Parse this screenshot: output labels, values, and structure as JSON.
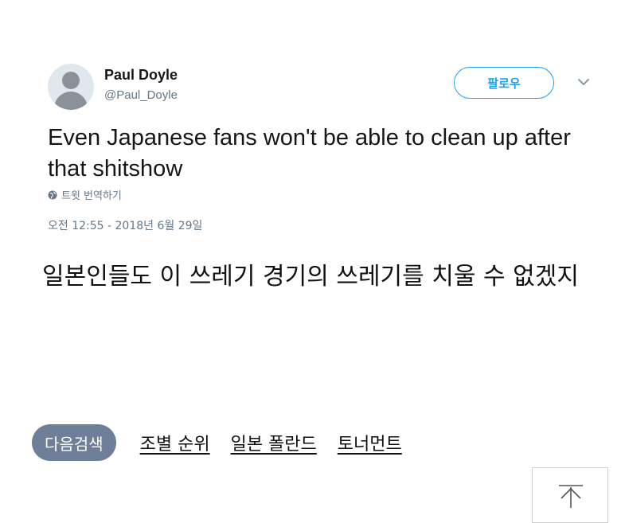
{
  "tweet": {
    "display_name": "Paul Doyle",
    "handle": "@Paul_Doyle",
    "follow_label": "팔로우",
    "text": "Even Japanese fans won't be able to clean up after that shitshow",
    "translate_label": "트윗 번역하기",
    "timestamp": "오전 12:55 - 2018년 6월 29일",
    "icons": {
      "more": "chevron-down-icon",
      "translate": "globe-icon"
    }
  },
  "caption": "일본인들도 이 쓰레기 경기의 쓰레기를 치울 수 없겠지",
  "search": {
    "label": "다음검색",
    "links": [
      "조별 순위",
      "일본 폴란드",
      "토너먼트"
    ]
  },
  "colors": {
    "accent": "#1da1f2",
    "pill": "#6f7f99",
    "muted": "#657786"
  }
}
